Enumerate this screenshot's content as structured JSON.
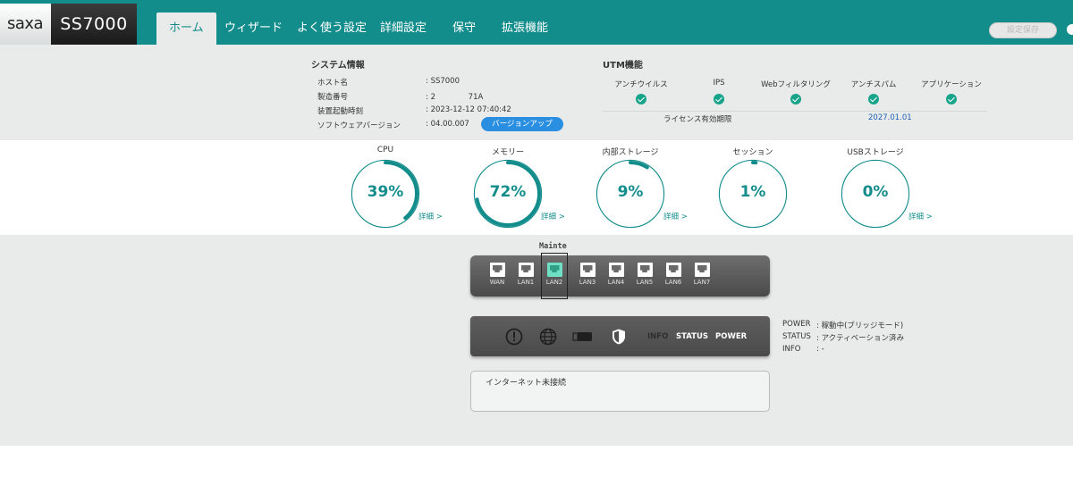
{
  "header": {
    "brand": "saxa",
    "model": "SS7000",
    "tabs": [
      {
        "label": "ホーム",
        "active": true
      },
      {
        "label": "ウィザード"
      },
      {
        "label": "よく使う設定"
      },
      {
        "label": "詳細設定"
      },
      {
        "label": "保守"
      },
      {
        "label": "拡張機能"
      }
    ],
    "save_label": "設定保存"
  },
  "system_info": {
    "title": "システム情報",
    "rows": [
      {
        "key": "ホスト名",
        "value": ": SS7000"
      },
      {
        "key": "製造番号",
        "value": ": 2　　　　 71A"
      },
      {
        "key": "装置起動時刻",
        "value": ": 2023-12-12 07:40:42"
      },
      {
        "key": "ソフトウェアバージョン",
        "value": ": 04.00.007"
      }
    ],
    "version_up_label": "バージョンアップ"
  },
  "utm": {
    "title": "UTM機能",
    "features": [
      "アンチウイルス",
      "IPS",
      "Webフィルタリング",
      "アンチスパム",
      "アプリケーション"
    ],
    "license_label": "ライセンス有効期限",
    "license_value": "2027.01.01"
  },
  "gauges": [
    {
      "title": "CPU",
      "value": "39%",
      "percent": 39,
      "detail": "詳細 >"
    },
    {
      "title": "メモリー",
      "value": "72%",
      "percent": 72,
      "detail": "詳細 >"
    },
    {
      "title": "内部ストレージ",
      "value": "9%",
      "percent": 9,
      "detail": "詳細 >"
    },
    {
      "title": "セッション",
      "value": "1%",
      "percent": 1,
      "detail": ""
    },
    {
      "title": "USBストレージ",
      "value": "0%",
      "percent": 0,
      "detail": "詳細 >"
    }
  ],
  "ports": {
    "maintenance_label": "Mainte",
    "items": [
      "WAN",
      "LAN1",
      "LAN2",
      "LAN3",
      "LAN4",
      "LAN5",
      "LAN6",
      "LAN7"
    ],
    "active_index": 2
  },
  "status_panel": {
    "icons": [
      "alert-icon",
      "globe-icon",
      "usb-icon",
      "shield-icon"
    ],
    "info_label": "INFO",
    "status_label": "STATUS",
    "power_label": "POWER"
  },
  "status_details": [
    {
      "key": "POWER",
      "value": ": 稼動中(ブリッジモード)"
    },
    {
      "key": "STATUS",
      "value": ": アクティベーション済み"
    },
    {
      "key": "INFO",
      "value": ": -"
    }
  ],
  "message": "インターネット未接続",
  "colors": {
    "accent": "#138d8c",
    "check": "#17a48a",
    "button_blue": "#2a8fe0"
  }
}
